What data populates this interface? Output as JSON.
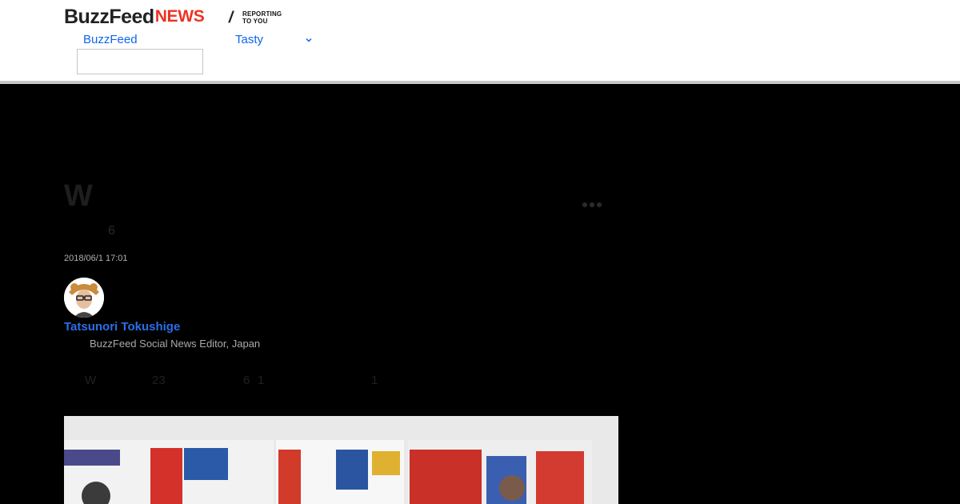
{
  "header": {
    "logo_main": "BuzzFeed",
    "logo_accent": "NEWS",
    "logo_slash": "/",
    "logo_tagline_1": "REPORTING",
    "logo_tagline_2": "TO YOU",
    "nav": [
      {
        "label": "BuzzFeed"
      },
      {
        "label": "Tasty"
      }
    ],
    "search": {
      "value": "",
      "placeholder": ""
    }
  },
  "article": {
    "title": "W",
    "subtitle_fragment": "6",
    "timestamp": "2018/06/1 17:01",
    "author": {
      "name": "Tatsunori Tokushige",
      "role": "BuzzFeed Social News Editor, Japan"
    },
    "lede_fragments": [
      "W",
      "23",
      "6",
      "1",
      "1"
    ]
  },
  "colors": {
    "brand_red": "#e32222",
    "link_blue": "#0f65ef",
    "author_blue": "#2b6fe8",
    "page_bg": "#000000"
  }
}
